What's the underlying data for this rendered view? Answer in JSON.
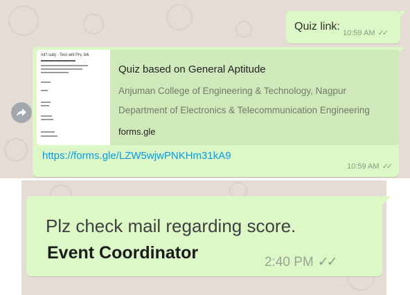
{
  "messages": {
    "quiz_link": {
      "text": "Quiz link:",
      "time": "10:59 AM"
    },
    "link_preview": {
      "title": "Quiz based on General Aptitude",
      "line1": "Anjuman College of Engineering & Technology, Nagpur",
      "line2": "Department of Electronics & Telecommunication Engineering",
      "domain": "forms.gle",
      "url": "https://forms.gle/LZW5wjwPNKHm31kA9",
      "time": "10:59 AM"
    },
    "score": {
      "line1": "Plz check mail regarding score.",
      "line2": "Event Coordinator",
      "time": "2:40 PM"
    }
  },
  "icons": {
    "forward": "forward-share-icon",
    "read": "double-check-icon"
  },
  "colors": {
    "chat_bg": "#e5ddd5",
    "bubble": "#dcf8c6",
    "link": "#039be5"
  }
}
